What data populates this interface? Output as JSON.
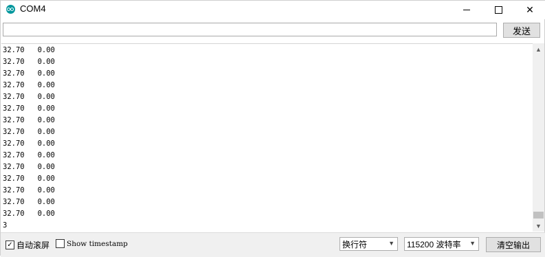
{
  "window": {
    "title": "COM4",
    "minimize_glyph": "",
    "close_glyph": "✕"
  },
  "send": {
    "input_value": "",
    "button_label": "发送"
  },
  "output": {
    "lines": [
      "32.70   0.00",
      "32.70   0.00",
      "32.70   0.00",
      "32.70   0.00",
      "32.70   0.00",
      "32.70   0.00",
      "32.70   0.00",
      "32.70   0.00",
      "32.70   0.00",
      "32.70   0.00",
      "32.70   0.00",
      "32.70   0.00",
      "32.70   0.00",
      "32.70   0.00",
      "32.70   0.00",
      "3"
    ]
  },
  "bottom": {
    "autoscroll_label": "自动滚屏",
    "autoscroll_checked": true,
    "timestamp_label": "Show timestamp",
    "timestamp_checked": false,
    "line_ending_selected": "换行符",
    "baud_selected": "115200 波特率",
    "clear_label": "清空输出"
  },
  "colors": {
    "app_icon": "#00979d"
  },
  "icons": {
    "app": "arduino-icon",
    "scroll_up": "▲",
    "scroll_down": "▼",
    "dropdown": "⌄"
  }
}
